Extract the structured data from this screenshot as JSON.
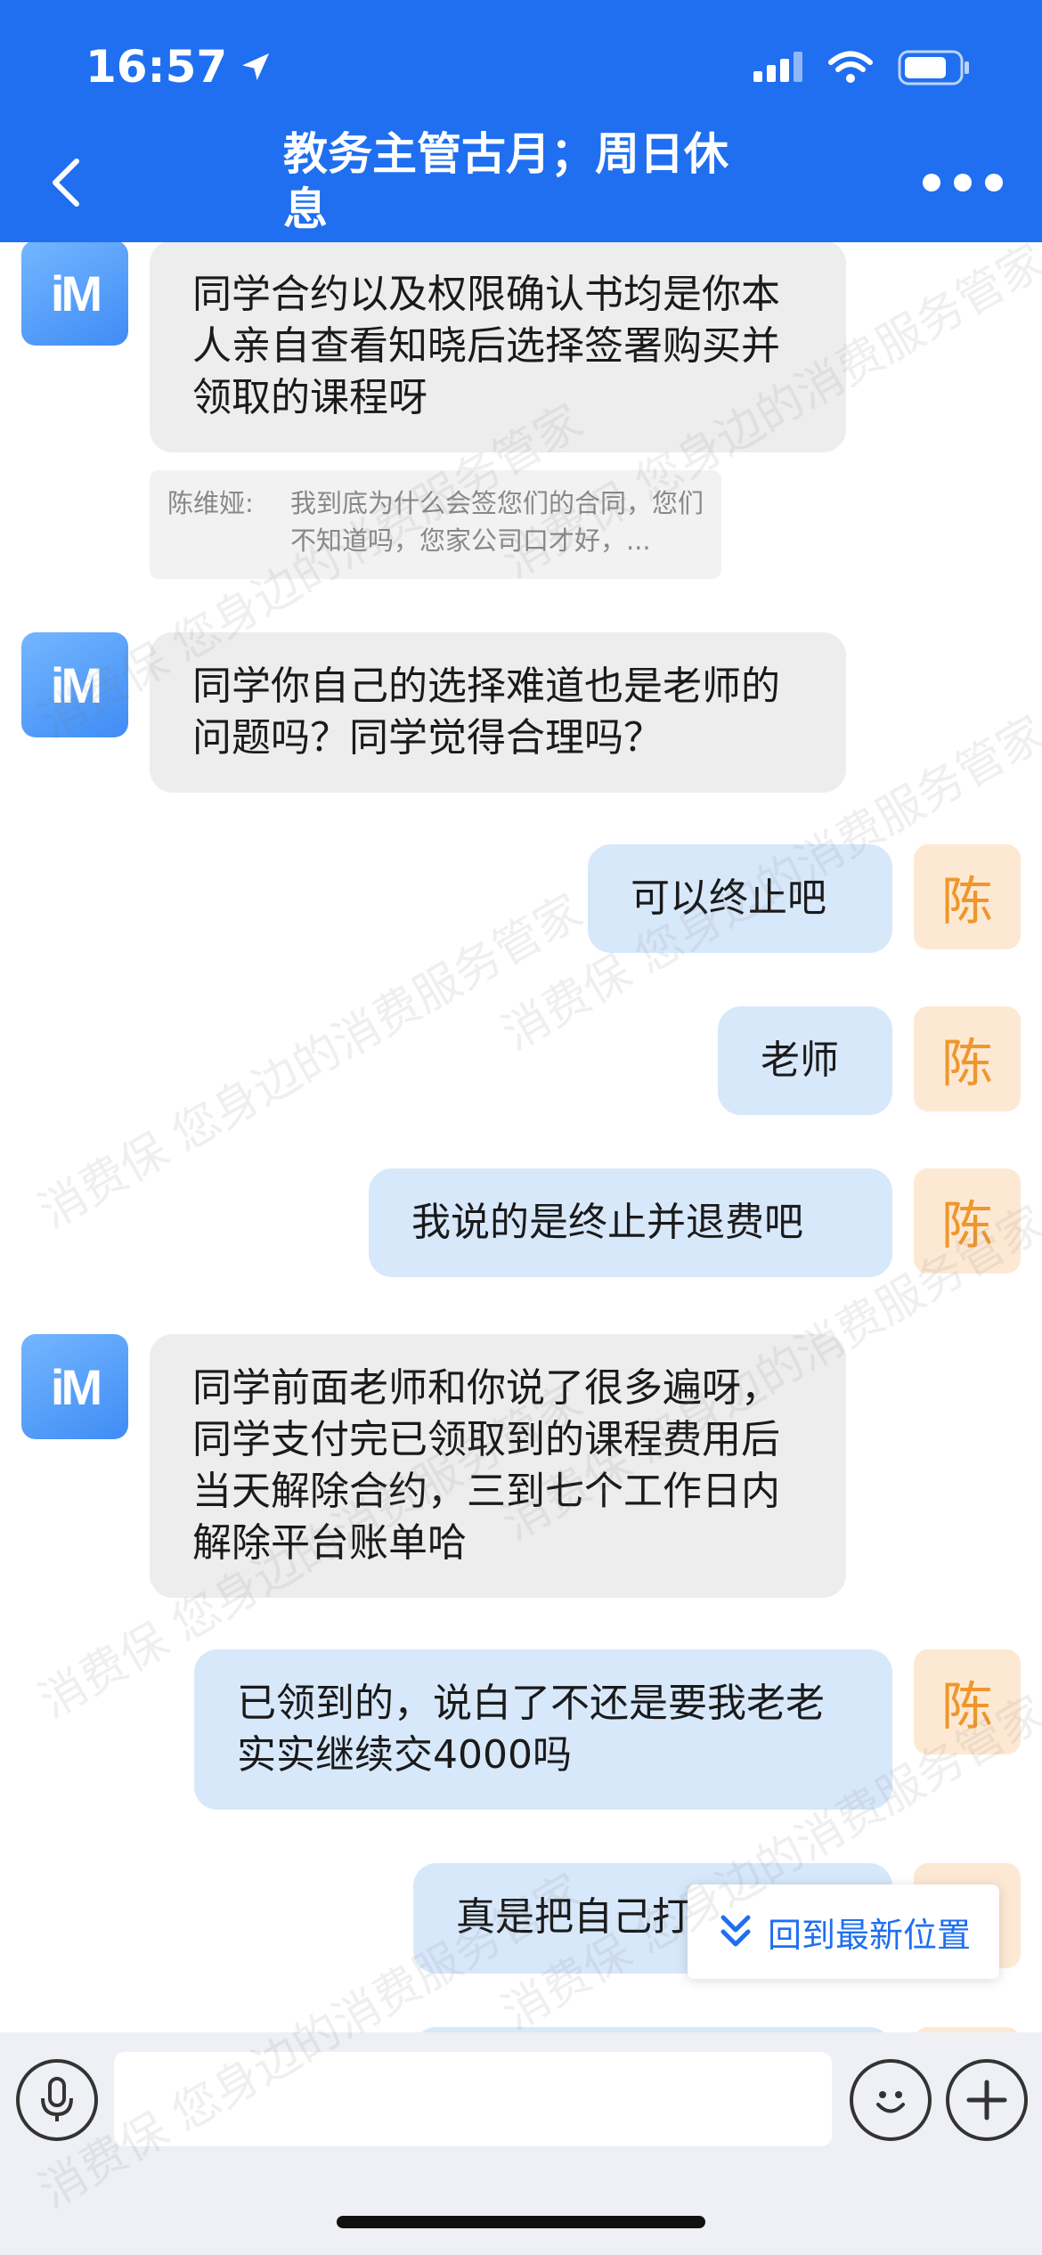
{
  "status_bar": {
    "time": "16:57"
  },
  "header": {
    "title": "教务主管古月；周日休息"
  },
  "messages": {
    "m1": "同学合约以及权限确认书均是你本人亲自查看知晓后选择签署购买并领取的课程呀",
    "quote_name": "陈维娅:",
    "quote_text": "我到底为什么会签您们的合同，您们不知道吗，您家公司口才好，...",
    "m2": "同学你自己的选择难道也是老师的问题吗？同学觉得合理吗？",
    "m3": "可以终止吧",
    "m4": "老师",
    "m5": "我说的是终止并退费吧",
    "m6": "同学前面老师和你说了很多遍呀，同学支付完已领取到的课程费用后当天解除合约，三到七个工作日内解除平台账单哈",
    "m7": "已领到的，说白了不还是要我老老实实继续交4000吗",
    "m8": "真是把自己打"
  },
  "avatars": {
    "agent_logo": "iM",
    "user_char": "陈"
  },
  "jump_to_latest": "回到最新位置",
  "watermark": "消费保 您身边的消费服务管家",
  "colors": {
    "header": "#1f6ff0",
    "bubble_out": "#d8e8fb",
    "bubble_in": "#ededee",
    "user_avatar": "#fde9d3"
  },
  "icons": [
    "location-arrow-icon",
    "signal-icon",
    "wifi-icon",
    "battery-icon",
    "back-chevron-icon",
    "more-dots-icon",
    "chevron-double-down-icon",
    "microphone-icon",
    "emoji-icon",
    "plus-icon"
  ]
}
